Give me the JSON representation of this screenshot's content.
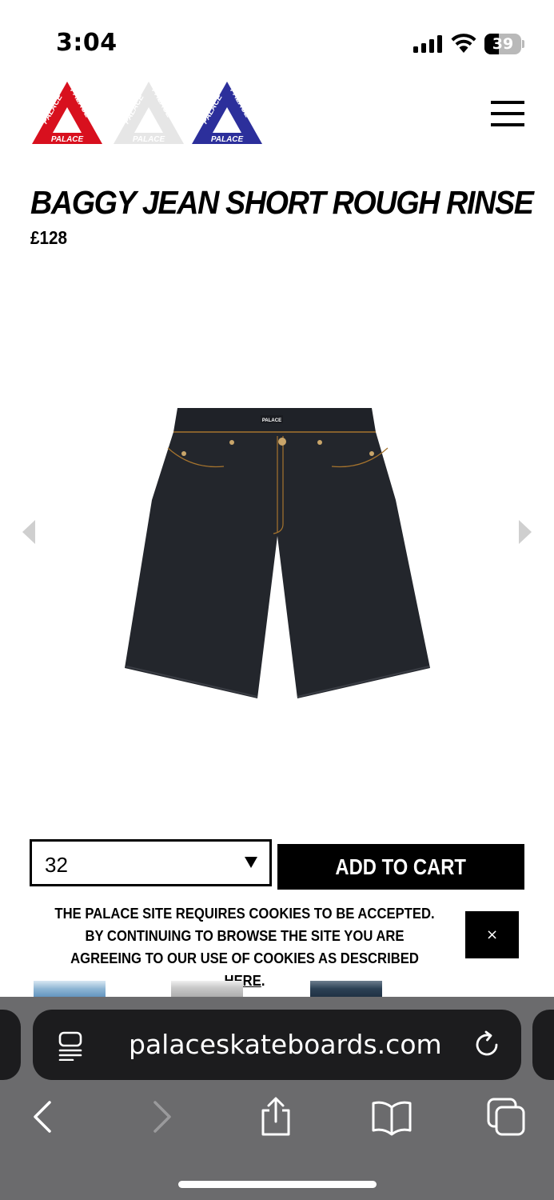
{
  "status_bar": {
    "time": "3:04",
    "battery_level": "39",
    "battery_percent": 39,
    "signal_icon": "cellular-signal-icon",
    "wifi_icon": "wifi-icon"
  },
  "header": {
    "logos": [
      {
        "name": "palace-logo-red",
        "text": "PALACE",
        "color": "#d8101e"
      },
      {
        "name": "palace-logo-white",
        "text": "PALACE",
        "color": "#e6e6e6"
      },
      {
        "name": "palace-logo-blue",
        "text": "PALACE",
        "color": "#2c2f9b"
      }
    ],
    "menu_icon": "hamburger-menu-icon"
  },
  "product": {
    "title": "BAGGY JEAN SHORT ROUGH RINSE",
    "price": "£128",
    "image_label": "PALACE",
    "prev_icon": "chevron-left-icon",
    "next_icon": "chevron-right-icon"
  },
  "purchase": {
    "selected_size": "32",
    "add_to_cart_label": "ADD TO CART"
  },
  "cookie_banner": {
    "text": "THE PALACE SITE REQUIRES COOKIES TO BE ACCEPTED. BY CONTINUING TO BROWSE THE SITE YOU ARE AGREEING TO OUR USE OF COOKIES AS DESCRIBED ",
    "link_text": "HERE",
    "suffix": ".",
    "close_label": "×"
  },
  "browser": {
    "url": "palaceskateboards.com",
    "toolbar": [
      "back-icon",
      "forward-icon",
      "share-icon",
      "bookmarks-icon",
      "tabs-icon"
    ]
  },
  "colors": {
    "accent": "#000000",
    "chrome": "#6b6b6d",
    "address_bar": "#1c1c1e"
  }
}
